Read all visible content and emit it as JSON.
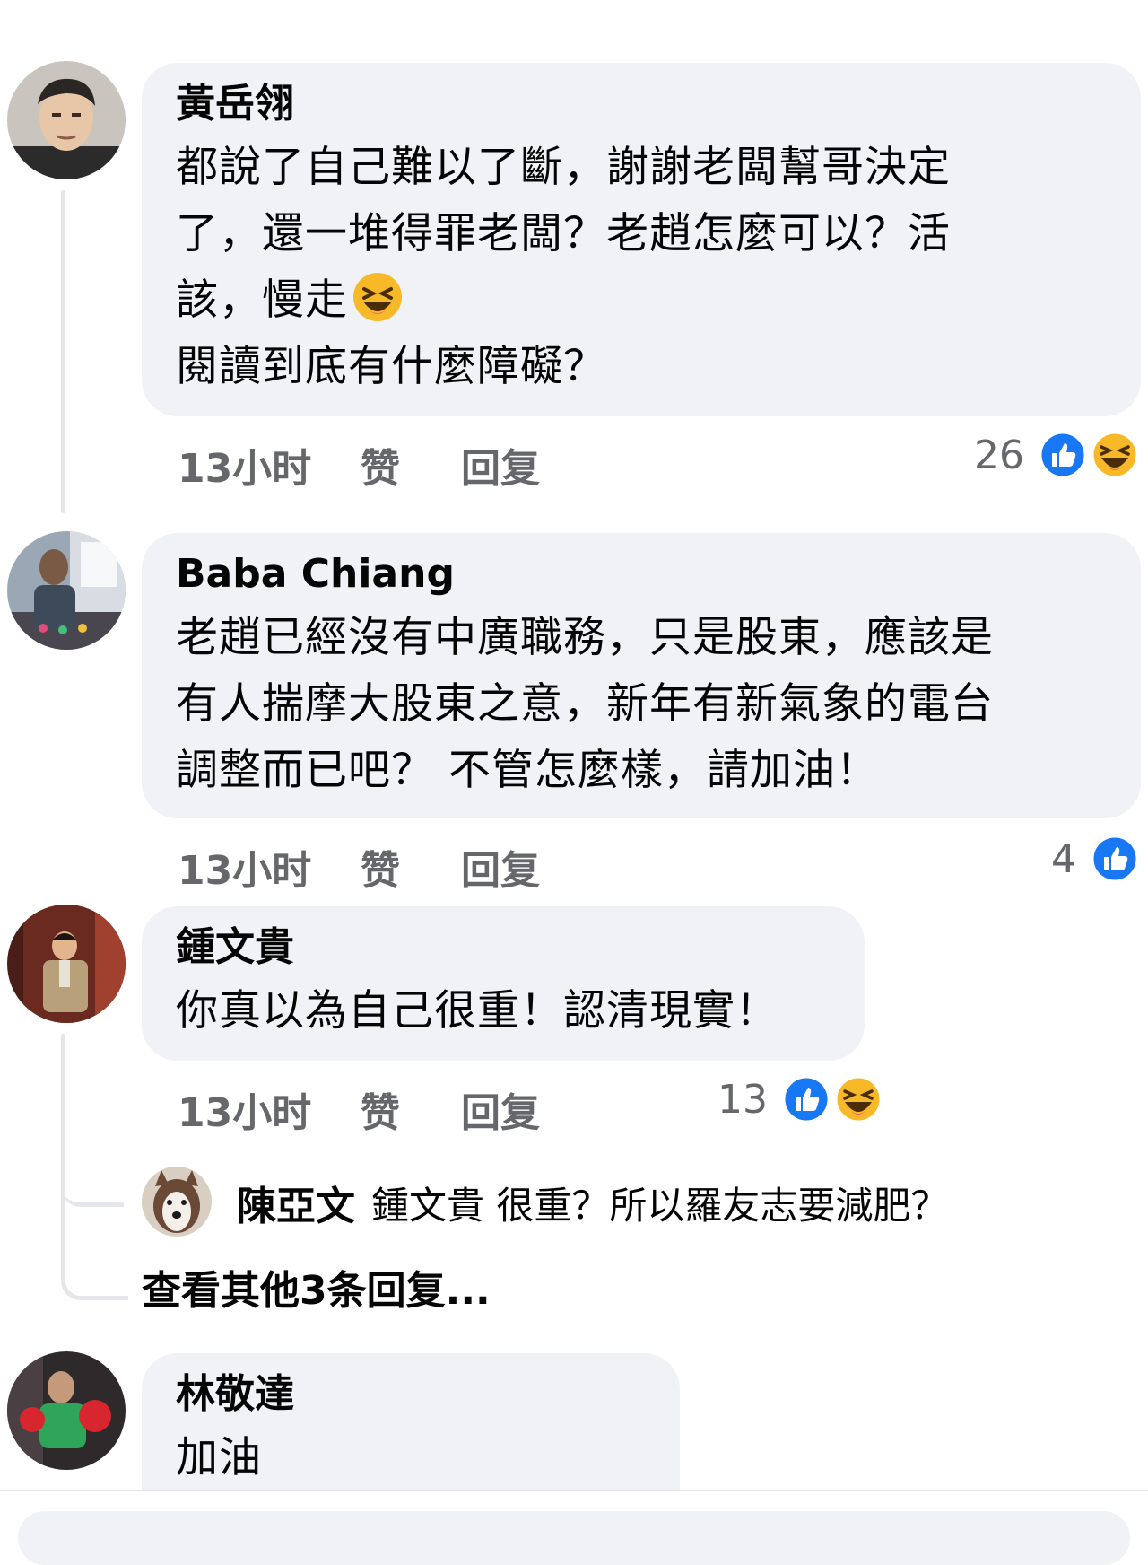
{
  "comments": [
    {
      "author": "黃岳翎",
      "lines": [
        "都說了自己難以了斷，謝謝老闆幫哥決定",
        "了，還一堆得罪老闆？老趙怎麼可以？活",
        "該，慢走",
        "閱讀到底有什麼障礙？"
      ],
      "time": "13小时",
      "like_label": "赞",
      "reply_label": "回复",
      "reaction_count": "26",
      "reactions": [
        "like-icon",
        "haha-icon"
      ],
      "inline_emoji": "laughing-emoji"
    },
    {
      "author": "Baba Chiang",
      "lines": [
        "老趙已經沒有中廣職務，只是股東，應該是",
        "有人揣摩大股東之意，新年有新氣象的電台",
        "調整而已吧？  不管怎麼樣，請加油！"
      ],
      "time": "13小时",
      "like_label": "赞",
      "reply_label": "回复",
      "reaction_count": "4",
      "reactions": [
        "like-icon"
      ]
    },
    {
      "author": "鍾文貴",
      "lines": [
        "你真以為自己很重！認清現實！"
      ],
      "time": "13小时",
      "like_label": "赞",
      "reply_label": "回复",
      "reaction_count": "13",
      "reactions": [
        "like-icon",
        "haha-icon"
      ],
      "reply": {
        "author": "陳亞文",
        "text": "鍾文貴 很重？所以羅友志要減肥？"
      },
      "more_replies": "查看其他3条回复..."
    },
    {
      "author": "林敬達",
      "lines": [
        "加油"
      ]
    }
  ],
  "colors": {
    "bubble": "#f0f2f5",
    "meta": "#65676b",
    "like_blue": "#1877f2",
    "haha_yellow": "#f7b928"
  }
}
